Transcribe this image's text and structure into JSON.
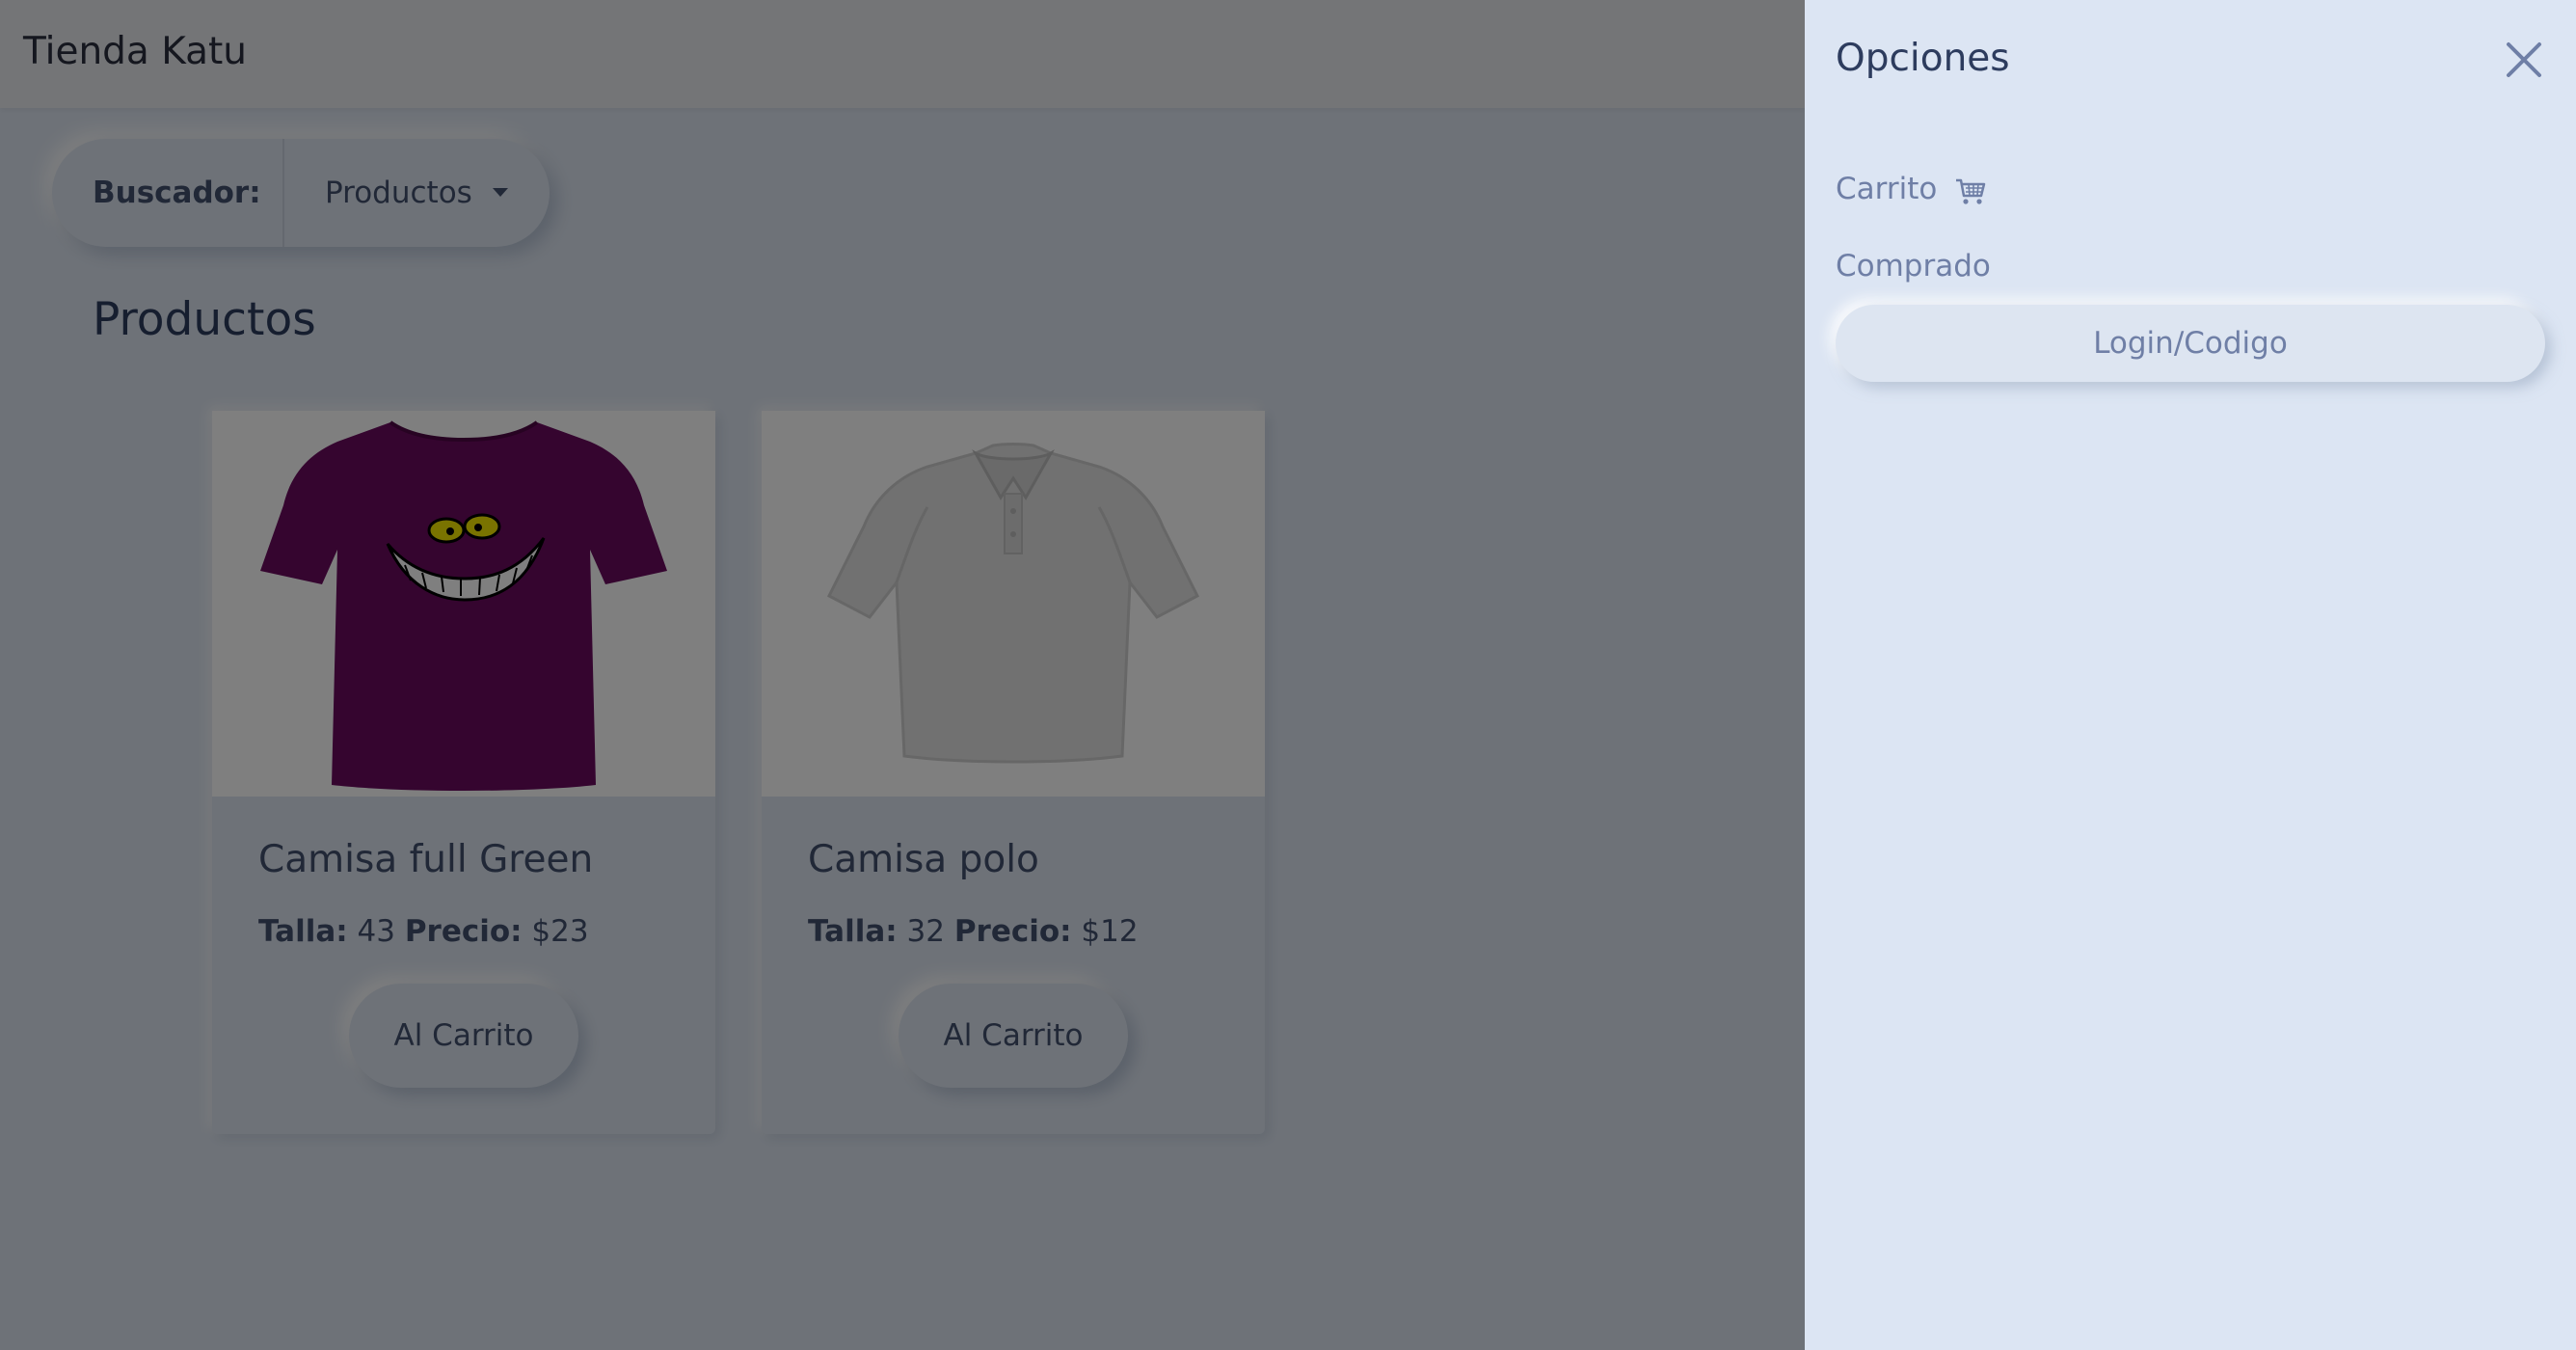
{
  "navbar": {
    "brand": "Tienda Katu"
  },
  "search": {
    "label": "Buscador:",
    "dropdown_value": "Productos"
  },
  "section": {
    "title": "Productos"
  },
  "products": [
    {
      "name": "Camisa full Green",
      "size_label": "Talla:",
      "size": "43",
      "price_label": "Precio:",
      "price": "$23",
      "button": "Al Carrito",
      "image": "purple-tshirt-smile-image"
    },
    {
      "name": "Camisa polo",
      "size_label": "Talla:",
      "size": "32",
      "price_label": "Precio:",
      "price": "$12",
      "button": "Al Carrito",
      "image": "grey-polo-shirt-image"
    }
  ],
  "offcanvas": {
    "title": "Opciones",
    "cart_link": "Carrito",
    "bought_link": "Comprado",
    "login_button": "Login/Codigo",
    "close_icon": "close-icon",
    "cart_icon": "shopping-cart-icon"
  },
  "colors": {
    "background": "#dde5f1",
    "text_dark": "#2d3c5e",
    "text_muted": "#6f7fa6",
    "overlay": "rgba(0,0,0,0.5)",
    "tshirt_purple": "#6a0a5e"
  }
}
